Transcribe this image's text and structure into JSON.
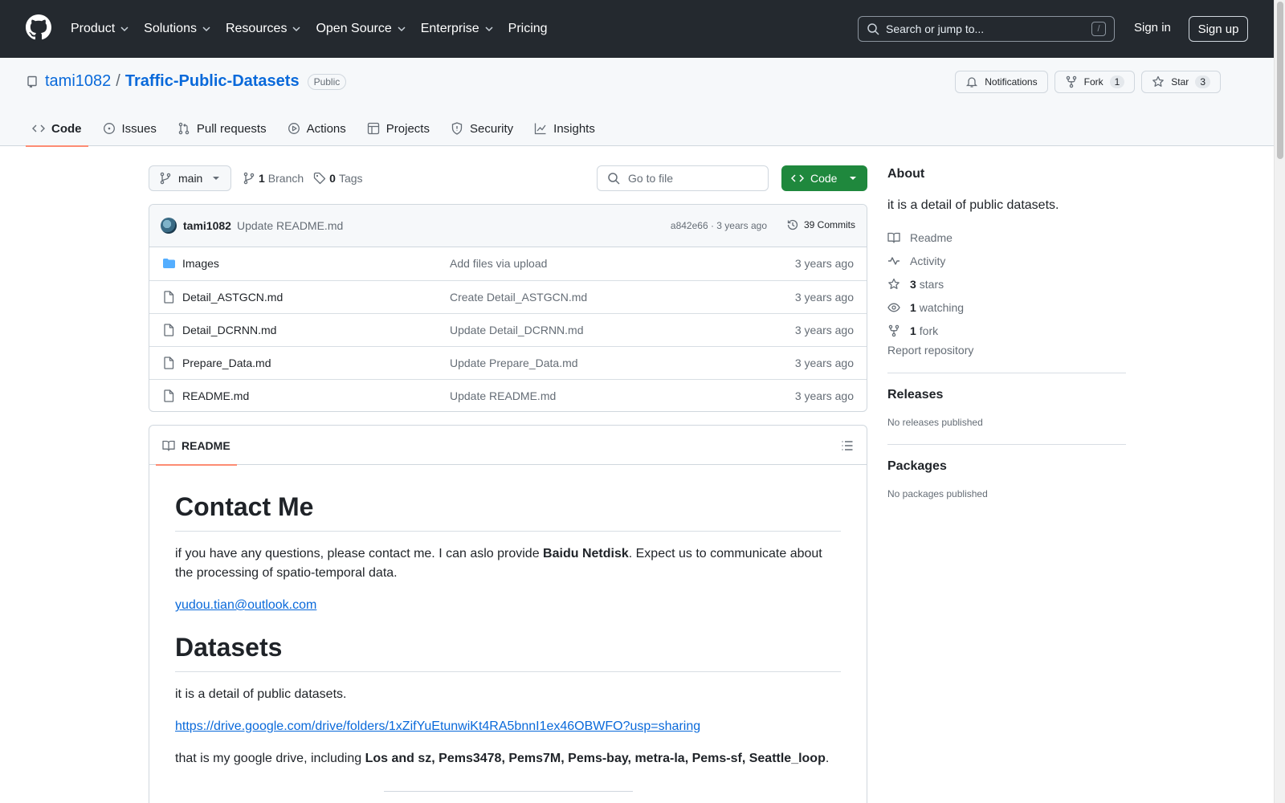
{
  "header": {
    "nav": [
      "Product",
      "Solutions",
      "Resources",
      "Open Source",
      "Enterprise",
      "Pricing"
    ],
    "search_placeholder": "Search or jump to...",
    "search_shortcut": "/",
    "signin": "Sign in",
    "signup": "Sign up"
  },
  "repo": {
    "owner": "tami1082",
    "separator": "/",
    "name": "Traffic-Public-Datasets",
    "visibility": "Public",
    "notifications_label": "Notifications",
    "fork_label": "Fork",
    "fork_count": "1",
    "star_label": "Star",
    "star_count": "3"
  },
  "tabs": [
    {
      "label": "Code",
      "icon": "code-icon",
      "active": true
    },
    {
      "label": "Issues",
      "icon": "issue-icon"
    },
    {
      "label": "Pull requests",
      "icon": "pull-request-icon"
    },
    {
      "label": "Actions",
      "icon": "play-icon"
    },
    {
      "label": "Projects",
      "icon": "table-icon"
    },
    {
      "label": "Security",
      "icon": "shield-icon"
    },
    {
      "label": "Insights",
      "icon": "graph-icon"
    }
  ],
  "toolbar": {
    "branch": "main",
    "branch_count": "1",
    "branch_word": "Branch",
    "tag_count": "0",
    "tag_word": "Tags",
    "go_to_file": "Go to file",
    "code_button": "Code"
  },
  "commit": {
    "author": "tami1082",
    "message": "Update README.md",
    "hash_time": "a842e66 · 3 years ago",
    "commits": "39 Commits"
  },
  "files": [
    {
      "type": "folder",
      "name": "Images",
      "message": "Add files via upload",
      "time": "3 years ago"
    },
    {
      "type": "file",
      "name": "Detail_ASTGCN.md",
      "message": "Create Detail_ASTGCN.md",
      "time": "3 years ago"
    },
    {
      "type": "file",
      "name": "Detail_DCRNN.md",
      "message": "Update Detail_DCRNN.md",
      "time": "3 years ago"
    },
    {
      "type": "file",
      "name": "Prepare_Data.md",
      "message": "Update Prepare_Data.md",
      "time": "3 years ago"
    },
    {
      "type": "file",
      "name": "README.md",
      "message": "Update README.md",
      "time": "3 years ago"
    }
  ],
  "readme": {
    "tab_label": "README",
    "h1_contact": "Contact Me",
    "p1_before": "if you have any questions, please contact me. I can aslo provide ",
    "p1_bold": "Baidu Netdisk",
    "p1_after": ". Expect us to communicate about the processing of spatio-temporal data.",
    "email": "yudou.tian@outlook.com",
    "h1_datasets": "Datasets",
    "p2": "it is a detail of public datasets.",
    "drive_link": "https://drive.google.com/drive/folders/1xZifYuEtunwiKt4RA5bnnI1ex46OBWFO?usp=sharing",
    "p3_before": "that is my google drive, including ",
    "p3_bold": "Los and sz, Pems3478, Pems7M, Pems-bay, metra-la, Pems-sf, Seattle_loop",
    "p3_after": "."
  },
  "sidebar": {
    "about_title": "About",
    "about_desc": "it is a detail of public datasets.",
    "readme": "Readme",
    "activity": "Activity",
    "stars_count": "3",
    "stars_word": "stars",
    "watching_count": "1",
    "watching_word": "watching",
    "fork_count": "1",
    "fork_word": "fork",
    "report": "Report repository",
    "releases_title": "Releases",
    "releases_empty": "No releases published",
    "packages_title": "Packages",
    "packages_empty": "No packages published"
  }
}
